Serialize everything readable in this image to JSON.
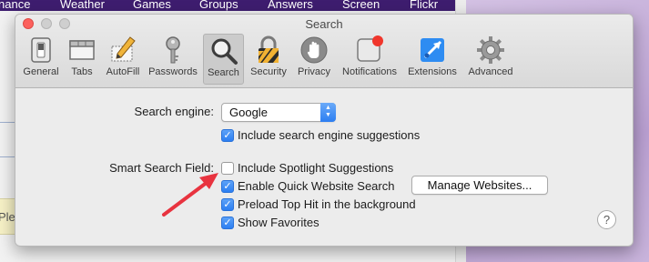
{
  "background": {
    "nav": [
      "nance",
      "Weather",
      "Games",
      "Groups",
      "Answers",
      "Screen",
      "Flickr"
    ],
    "partial_text": "Ple"
  },
  "window": {
    "title": "Search",
    "toolbar": [
      {
        "label": "General",
        "icon": "general-switch-icon"
      },
      {
        "label": "Tabs",
        "icon": "tabs-icon"
      },
      {
        "label": "AutoFill",
        "icon": "autofill-pencil-icon"
      },
      {
        "label": "Passwords",
        "icon": "key-icon"
      },
      {
        "label": "Search",
        "icon": "magnifier-icon",
        "selected": true
      },
      {
        "label": "Security",
        "icon": "padlock-icon"
      },
      {
        "label": "Privacy",
        "icon": "hand-icon"
      },
      {
        "label": "Notifications",
        "icon": "notification-badge-icon"
      },
      {
        "label": "Extensions",
        "icon": "extensions-puzzle-icon"
      },
      {
        "label": "Advanced",
        "icon": "gear-icon"
      }
    ]
  },
  "search": {
    "engine_label": "Search engine:",
    "engine_value": "Google",
    "include_suggestions": "Include search engine suggestions",
    "smart_field_label": "Smart Search Field:",
    "spotlight": "Include Spotlight Suggestions",
    "quick_website": "Enable Quick Website Search",
    "manage_websites": "Manage Websites...",
    "preload": "Preload Top Hit in the background",
    "favorites": "Show Favorites",
    "help": "?"
  },
  "checkbox_states": {
    "include_suggestions": true,
    "spotlight": false,
    "quick_website": true,
    "preload": true,
    "favorites": true
  },
  "colors": {
    "accent": "#2c7ef2",
    "arrow": "#e8333f",
    "nav_bg": "#3e1d6f"
  }
}
